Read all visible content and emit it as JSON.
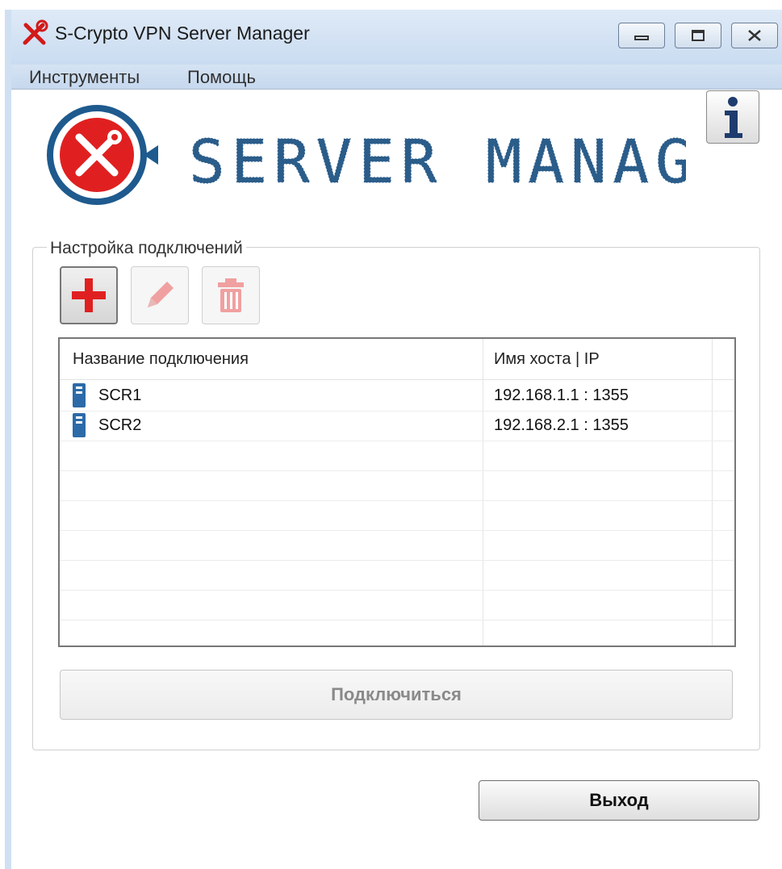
{
  "window": {
    "title": "S-Crypto VPN Server Manager"
  },
  "menubar": {
    "items": [
      {
        "label": "Инструменты"
      },
      {
        "label": "Помощь"
      }
    ]
  },
  "header": {
    "logo_icon": "tools-restart-icon",
    "banner_text": "SERVER MANAGER",
    "banner_color": "#2b5d8a",
    "info_icon": "info-icon"
  },
  "connections": {
    "group_title": "Настройка подключений",
    "toolbar": {
      "add_icon": "plus-icon",
      "edit_icon": "pencil-icon",
      "delete_icon": "trash-icon",
      "add_enabled": true,
      "edit_enabled": false,
      "delete_enabled": false
    },
    "columns": {
      "name": "Название подключения",
      "host": "Имя хоста | IP"
    },
    "rows": [
      {
        "name": "SCR1",
        "host": "192.168.1.1 : 1355",
        "icon": "server-icon"
      },
      {
        "name": "SCR2",
        "host": "192.168.2.1 : 1355",
        "icon": "server-icon"
      }
    ],
    "connect_label": "Подключиться",
    "connect_enabled": false
  },
  "footer": {
    "exit_label": "Выход"
  },
  "colors": {
    "accent_red": "#e02020",
    "title_bar": "#dfeaf7",
    "logo_blue": "#1e5a8e"
  }
}
